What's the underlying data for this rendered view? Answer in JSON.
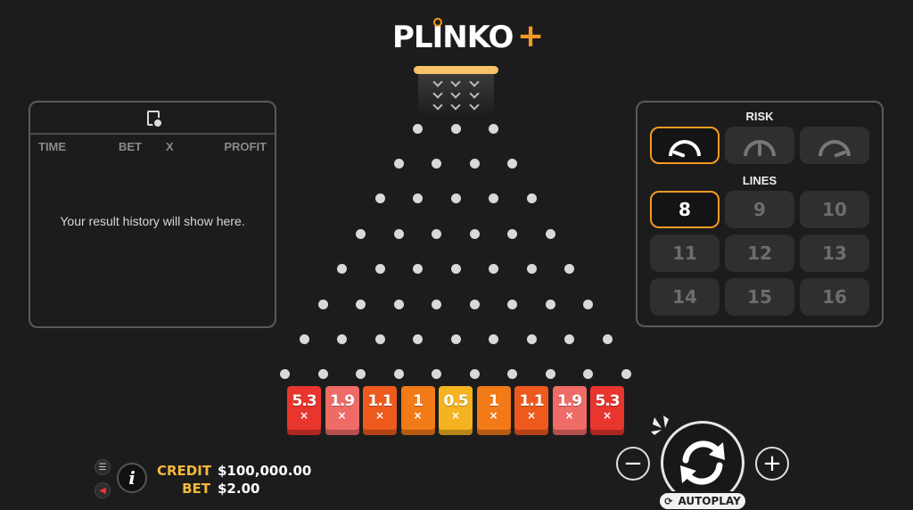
{
  "logo": {
    "text": "PLINKO",
    "plus": "+"
  },
  "history": {
    "columns": [
      "TIME",
      "BET",
      "X",
      "PROFIT"
    ],
    "empty_message": "Your result history will show here."
  },
  "settings": {
    "risk_title": "RISK",
    "risk_options": [
      "low",
      "medium",
      "high"
    ],
    "risk_selected": "low",
    "lines_title": "LINES",
    "lines_options": [
      "8",
      "9",
      "10",
      "11",
      "12",
      "13",
      "14",
      "15",
      "16"
    ],
    "lines_selected": "8"
  },
  "board": {
    "rows": 8,
    "buckets": [
      {
        "value": "5.3",
        "x": "×",
        "color": "#e8352d"
      },
      {
        "value": "1.9",
        "x": "×",
        "color": "#ef6b66"
      },
      {
        "value": "1.1",
        "x": "×",
        "color": "#ee5a1e"
      },
      {
        "value": "1",
        "x": "×",
        "color": "#f27a17"
      },
      {
        "value": "0.5",
        "x": "×",
        "color": "#f5b321"
      },
      {
        "value": "1",
        "x": "×",
        "color": "#f27a17"
      },
      {
        "value": "1.1",
        "x": "×",
        "color": "#ee5a1e"
      },
      {
        "value": "1.9",
        "x": "×",
        "color": "#ef6b66"
      },
      {
        "value": "5.3",
        "x": "×",
        "color": "#e8352d"
      }
    ]
  },
  "footer": {
    "credit_label": "CREDIT",
    "credit_value": "$100,000.00",
    "bet_label": "BET",
    "bet_value": "$2.00",
    "minus": "−",
    "plus": "+",
    "autoplay_label": "AUTOPLAY"
  },
  "colors": {
    "accent": "#f59a23",
    "label": "#f5b93a"
  }
}
